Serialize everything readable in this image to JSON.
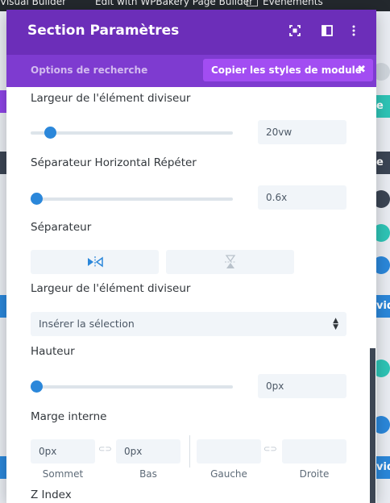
{
  "admin_bar": {
    "item1": "Visual Builder",
    "item2": "Edit with WPBakery Page Builder",
    "item3": "Événements"
  },
  "background": {
    "strip_letters": [
      "e",
      "e",
      "e",
      "vid",
      "vid"
    ]
  },
  "modal": {
    "title": "Section Paramètres",
    "icons": [
      "fullscreen-icon",
      "split-view-icon",
      "more-options-icon"
    ],
    "tabs": {
      "search": "Options de recherche",
      "copy_styles": "Copier les styles de module",
      "copy_close": "✖"
    }
  },
  "settings": {
    "divider_width": {
      "label": "Largeur de l'élément diviseur",
      "value": "20vw",
      "slider_fraction": 0.07
    },
    "horizontal_repeat": {
      "label": "Séparateur Horizontal Répéter",
      "value": "0.6x",
      "slider_fraction": 0.0
    },
    "separator": {
      "label": "Séparateur",
      "options": [
        "flip-horizontal-icon",
        "flip-vertical-icon"
      ]
    },
    "divider_arrangement": {
      "label": "Largeur de l'élément diviseur",
      "select_value": "Insérer la sélection"
    },
    "height": {
      "label": "Hauteur",
      "value": "0px",
      "slider_fraction": 0.0
    },
    "padding": {
      "label": "Marge interne",
      "top": {
        "value": "0px",
        "caption": "Sommet"
      },
      "bottom": {
        "value": "0px",
        "caption": "Bas"
      },
      "left": {
        "value": "",
        "caption": "Gauche"
      },
      "right": {
        "value": "",
        "caption": "Droite"
      }
    },
    "z_index": {
      "label": "Z Index"
    }
  },
  "colors": {
    "header": "#6c2eb9",
    "tabs_bar": "#7e3bd0",
    "copy_button": "#a24df2",
    "slider_thumb": "#2b87da"
  }
}
